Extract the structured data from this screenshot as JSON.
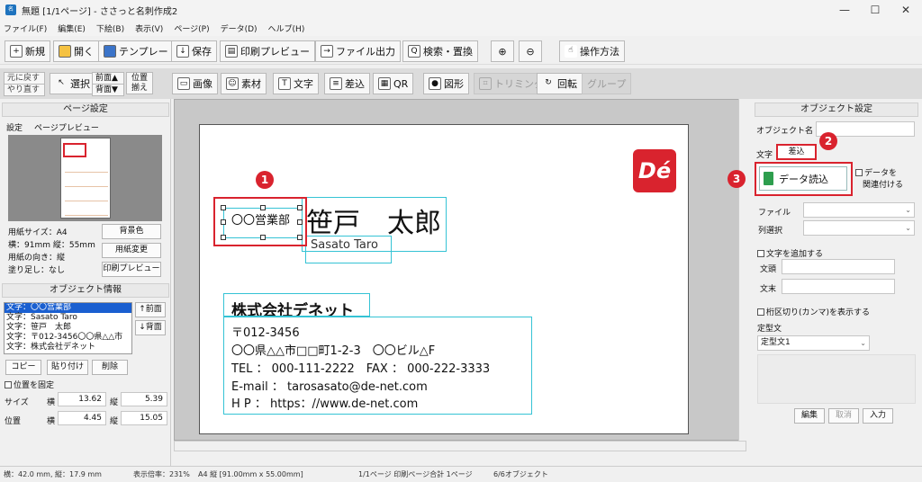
{
  "window": {
    "title": "無題 [1/1ページ] - ささっと名刺作成2",
    "minimize": "—",
    "maximize": "☐",
    "close": "✕"
  },
  "menu": [
    "ファイル(F)",
    "編集(E)",
    "下絵(B)",
    "表示(V)",
    "ページ(P)",
    "データ(D)",
    "ヘルプ(H)"
  ],
  "toolbar1": {
    "new": "新規",
    "open": "開く",
    "template": "テンプレート",
    "save": "保存",
    "print_preview": "印刷プレビュー",
    "file_output": "ファイル出力",
    "search_replace": "検索・置換",
    "zoom_in": "⊕",
    "zoom_out": "⊖",
    "howto": "操作方法"
  },
  "toolbar2": {
    "undo": "元に戻す",
    "redo": "やり直す",
    "select": "選択",
    "front": "前面▲",
    "back": "背面▼",
    "align1": "位置",
    "align2": "揃え",
    "image": "画像",
    "material": "素材",
    "text": "文字",
    "merge": "差込",
    "qr": "QR",
    "shape": "図形",
    "trim": "トリミング",
    "rotate": "回転",
    "group": "グループ"
  },
  "page_settings": {
    "header": "ページ設定",
    "tab_settings": "設定",
    "tab_preview": "ページプレビュー",
    "paper_size": "用紙サイズ：A4",
    "dims": "横：91mm 縦：55mm",
    "orientation": "用紙の向き：縦",
    "bleed": "塗り足し：なし",
    "bg_color": "背景色",
    "change_paper": "用紙変更",
    "print_preview": "印刷プレビュー"
  },
  "object_info": {
    "header": "オブジェクト情報",
    "items": [
      "文字：〇〇営業部",
      "文字：Sasato Taro",
      "文字：笹戸　太郎",
      "文字：〒012-3456〇〇県△△市",
      "文字：株式会社デネット"
    ],
    "front": "↑前面",
    "back": "↓背面",
    "copy": "コピー",
    "paste": "貼り付け",
    "delete": "削除",
    "fix_position": "位置を固定",
    "size_label": "サイズ",
    "pos_label": "位置",
    "w_label": "横",
    "h_label": "縦",
    "size_w": "13.62",
    "size_h": "5.39",
    "pos_x": "4.45",
    "pos_y": "15.05"
  },
  "card": {
    "dept": "〇〇営業部",
    "name": "笹戸　太郎",
    "romaji": "Sasato Taro",
    "company": "株式会社デネット",
    "postal": "〒012-3456",
    "address": "〇〇県△△市□□町1-2-3　〇〇ビル△F",
    "tel": "TEL ： 000-111-2222　FAX ： 000-222-3333",
    "email": "E-mail ： tarosasato@de-net.com",
    "hp": "H P ： https：//www.de-net.com",
    "logo": "Dé"
  },
  "badges": [
    "1",
    "2",
    "3"
  ],
  "object_settings": {
    "header": "オブジェクト設定",
    "name_label": "オブジェクト名",
    "tab_text": "文字",
    "tab_merge": "差込",
    "load_data": "データ読込",
    "link_data1": "データを",
    "link_data2": "関連付ける",
    "file_label": "ファイル",
    "column_label": "列選択",
    "add_text": "文字を追加する",
    "prefix": "文頭",
    "suffix": "文末",
    "show_comma": "桁区切り(カンマ)を表示する",
    "template_label": "定型文",
    "template_value": "定型文1",
    "edit": "編集",
    "cancel": "取消",
    "input": "入力"
  },
  "status": {
    "pos": "横：42.0 mm, 縦：17.9 mm",
    "zoom": "表示倍率：231%",
    "paper": "A4 縦 [91.00mm x 55.00mm]",
    "pages": "1/1ページ 印刷ページ合計 1ページ",
    "objects": "6/6オブジェクト"
  },
  "colors": {
    "accent_red": "#d9232e",
    "selection_cyan": "#35c3d5"
  }
}
